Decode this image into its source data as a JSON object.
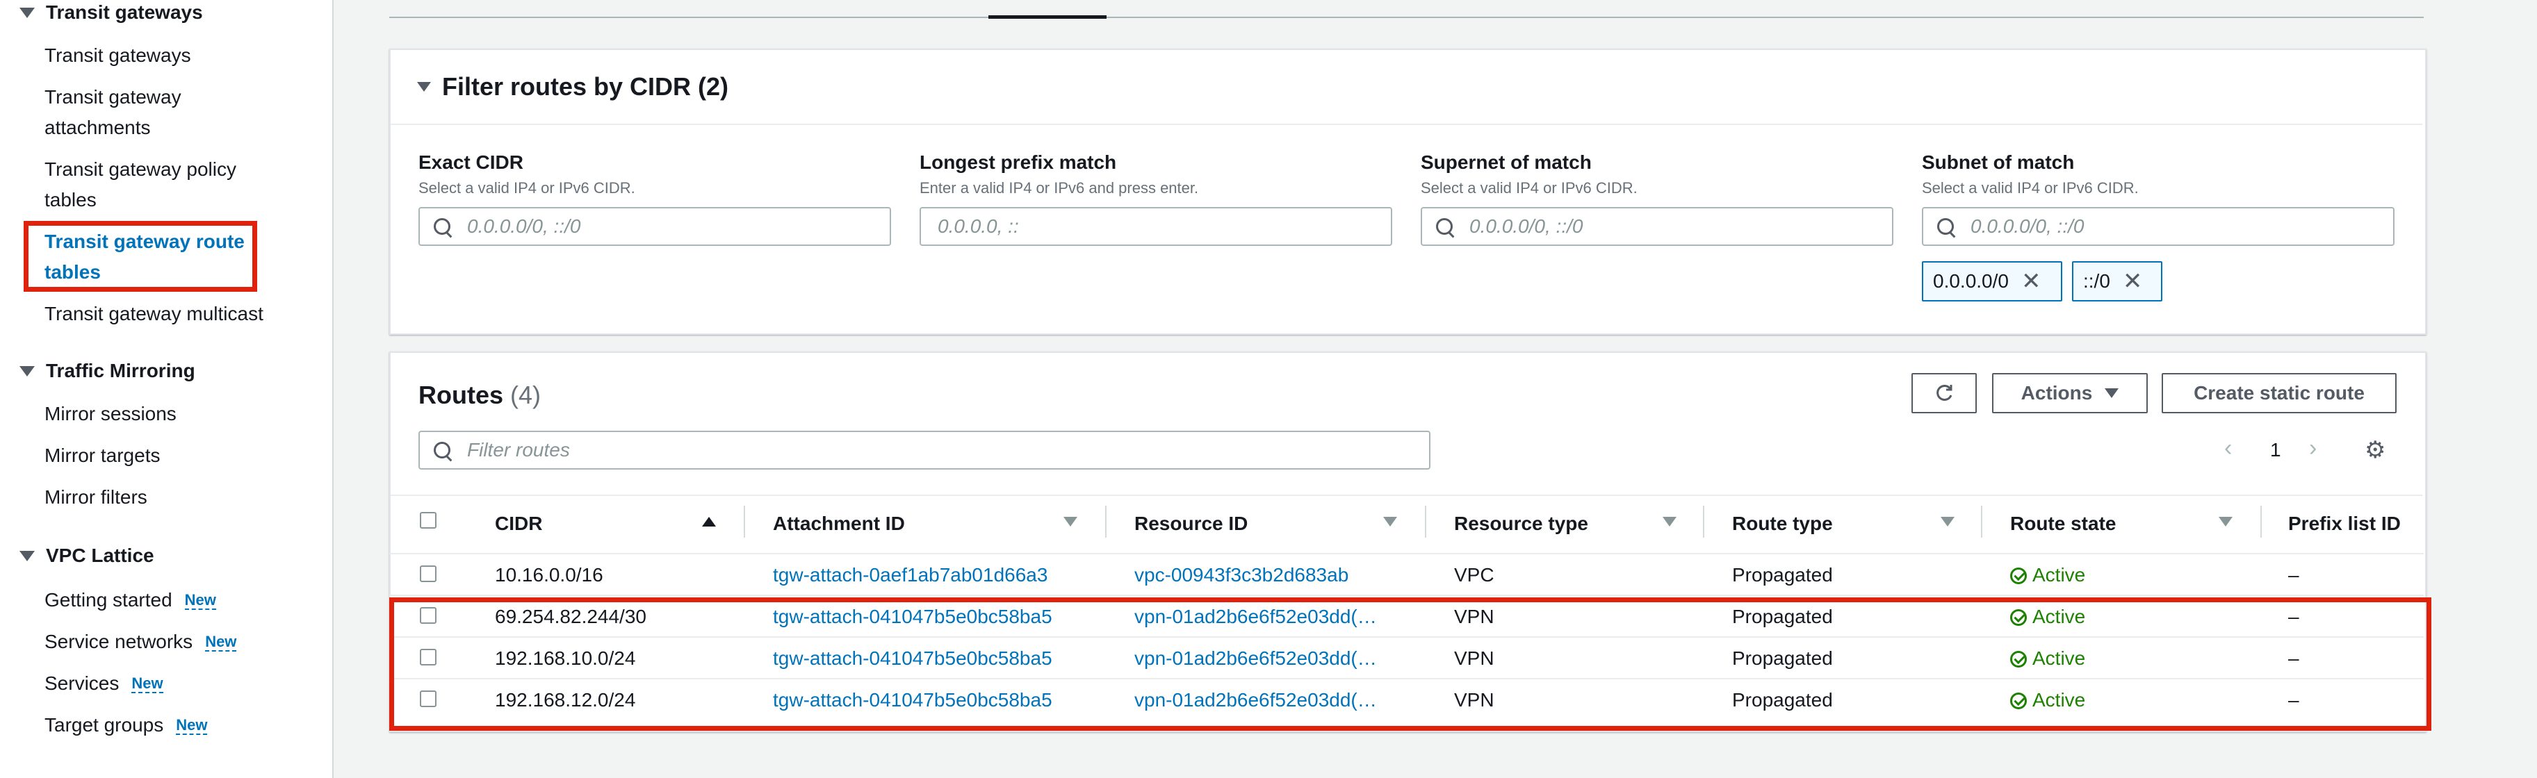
{
  "sidebar": {
    "sections": [
      {
        "title": "Transit gateways",
        "items": [
          "Transit gateways",
          "Transit gateway attachments",
          "Transit gateway policy tables",
          "Transit gateway route tables",
          "Transit gateway multicast"
        ]
      },
      {
        "title": "Traffic Mirroring",
        "items": [
          "Mirror sessions",
          "Mirror targets",
          "Mirror filters"
        ]
      },
      {
        "title": "VPC Lattice",
        "items": [
          "Getting started",
          "Service networks",
          "Services",
          "Target groups"
        ]
      }
    ],
    "new_badge": "New"
  },
  "filter_panel": {
    "title": "Filter routes by CIDR (2)",
    "fields": [
      {
        "label": "Exact CIDR",
        "desc": "Select a valid IP4 or IPv6 CIDR.",
        "placeholder": "0.0.0.0/0, ::/0"
      },
      {
        "label": "Longest prefix match",
        "desc": "Enter a valid IP4 or IPv6 and press enter.",
        "placeholder": "0.0.0.0, ::"
      },
      {
        "label": "Supernet of match",
        "desc": "Select a valid IP4 or IPv6 CIDR.",
        "placeholder": "0.0.0.0/0, ::/0"
      },
      {
        "label": "Subnet of match",
        "desc": "Select a valid IP4 or IPv6 CIDR.",
        "placeholder": "0.0.0.0/0, ::/0"
      }
    ],
    "tokens": [
      "0.0.0.0/0",
      "::/0"
    ]
  },
  "routes": {
    "title": "Routes",
    "count": "(4)",
    "actions_label": "Actions",
    "create_label": "Create static route",
    "filter_placeholder": "Filter routes",
    "page_number": "1",
    "columns": [
      "CIDR",
      "Attachment ID",
      "Resource ID",
      "Resource type",
      "Route type",
      "Route state",
      "Prefix list ID"
    ],
    "rows": [
      {
        "cidr": "10.16.0.0/16",
        "attachment": "tgw-attach-0aef1ab7ab01d66a3",
        "resource": "vpc-00943f3c3b2d683ab",
        "type": "VPC",
        "route_type": "Propagated",
        "state": "Active",
        "prefix": "–"
      },
      {
        "cidr": "69.254.82.244/30",
        "attachment": "tgw-attach-041047b5e0bc58ba5",
        "resource": "vpn-01ad2b6e6f52e03dd(…",
        "type": "VPN",
        "route_type": "Propagated",
        "state": "Active",
        "prefix": "–"
      },
      {
        "cidr": "192.168.10.0/24",
        "attachment": "tgw-attach-041047b5e0bc58ba5",
        "resource": "vpn-01ad2b6e6f52e03dd(…",
        "type": "VPN",
        "route_type": "Propagated",
        "state": "Active",
        "prefix": "–"
      },
      {
        "cidr": "192.168.12.0/24",
        "attachment": "tgw-attach-041047b5e0bc58ba5",
        "resource": "vpn-01ad2b6e6f52e03dd(…",
        "type": "VPN",
        "route_type": "Propagated",
        "state": "Active",
        "prefix": "–"
      }
    ]
  },
  "colors": {
    "link": "#0073bb",
    "highlight": "#e0210c",
    "active": "#1d8102"
  }
}
